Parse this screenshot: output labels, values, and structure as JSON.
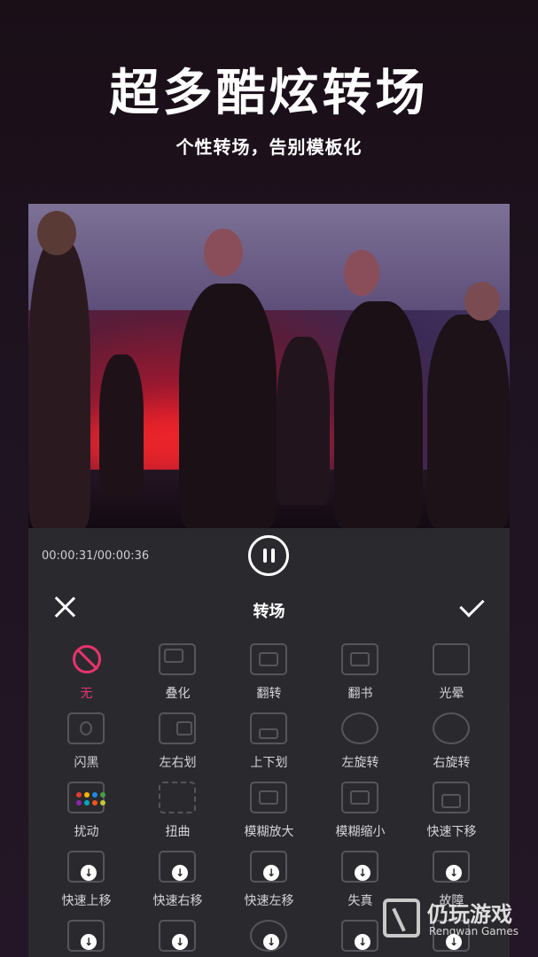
{
  "hero": {
    "title": "超多酷炫转场",
    "subtitle": "个性转场，告别模板化"
  },
  "player": {
    "timecode": "00:00:31/00:00:36",
    "state": "playing"
  },
  "panel": {
    "title": "转场",
    "close_icon": "close-icon",
    "confirm_icon": "check-icon",
    "accent": "#e8336c"
  },
  "transitions": [
    {
      "label": "无",
      "icon": "none-icon",
      "active": true
    },
    {
      "label": "叠化",
      "icon": "dissolve-icon"
    },
    {
      "label": "翻转",
      "icon": "flip-icon"
    },
    {
      "label": "翻书",
      "icon": "page-turn-icon"
    },
    {
      "label": "光晕",
      "icon": "glow-icon"
    },
    {
      "label": "闪黑",
      "icon": "flash-black-icon"
    },
    {
      "label": "左右划",
      "icon": "wipe-horizontal-icon"
    },
    {
      "label": "上下划",
      "icon": "wipe-vertical-icon"
    },
    {
      "label": "左旋转",
      "icon": "rotate-left-icon"
    },
    {
      "label": "右旋转",
      "icon": "rotate-right-icon"
    },
    {
      "label": "扰动",
      "icon": "glitch-dots-icon"
    },
    {
      "label": "扭曲",
      "icon": "distort-icon"
    },
    {
      "label": "模糊放大",
      "icon": "blur-zoom-in-icon"
    },
    {
      "label": "模糊缩小",
      "icon": "blur-zoom-out-icon"
    },
    {
      "label": "快速下移",
      "icon": "fast-down-icon"
    },
    {
      "label": "快速上移",
      "icon": "fast-up-icon",
      "download": true
    },
    {
      "label": "快速右移",
      "icon": "fast-right-icon",
      "download": true
    },
    {
      "label": "快速左移",
      "icon": "fast-left-icon",
      "download": true
    },
    {
      "label": "失真",
      "icon": "distortion-icon",
      "download": true
    },
    {
      "label": "故障",
      "icon": "glitch-icon",
      "download": true
    }
  ],
  "watermark": {
    "name": "仍玩游戏",
    "sub": "Rengwan Games"
  }
}
